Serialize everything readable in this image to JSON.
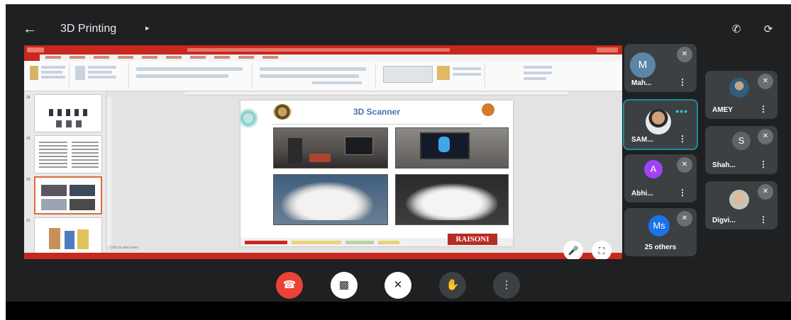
{
  "topbar": {
    "back_icon": "arrow-left-icon",
    "title": "3D Printing",
    "chevron": "▸",
    "call_icon": "phone-switch-icon",
    "camera_switch_icon": "camera-switch-icon"
  },
  "presentation": {
    "slide_title": "3D Scanner",
    "brand_text": "RAISONI",
    "notes_hint": "Click to add notes"
  },
  "participants": [
    {
      "name": "Mah...",
      "initial": "M",
      "avatar_color": "#5c86a8"
    },
    {
      "name": "AMEY",
      "initial": "",
      "avatar_color": "#9aa0a6"
    },
    {
      "name": "SAM...",
      "initial": "",
      "avatar_color": "#9aa0a6",
      "speaking": true
    },
    {
      "name": "Shah...",
      "initial": "S",
      "avatar_color": "#5f6368"
    },
    {
      "name": "Abhi...",
      "initial": "A",
      "avatar_color": "#a142f4"
    },
    {
      "name": "Digvi...",
      "initial": "",
      "avatar_color": "#9aa0a6"
    }
  ],
  "others_tile": {
    "initials": "Ms",
    "label": "25 others",
    "avatar_color": "#1a73e8"
  },
  "controls": {
    "end_call_icon": "end-call-icon",
    "camera_off_icon": "camera-off-icon",
    "mic_off_icon": "mic-off-icon",
    "raise_hand_icon": "raise-hand-icon",
    "more_icon": "more-options-icon"
  },
  "colors": {
    "end_call": "#ea4335",
    "background": "#1f2022",
    "tile": "#3c4043",
    "speaking": "#1a8e9a"
  }
}
